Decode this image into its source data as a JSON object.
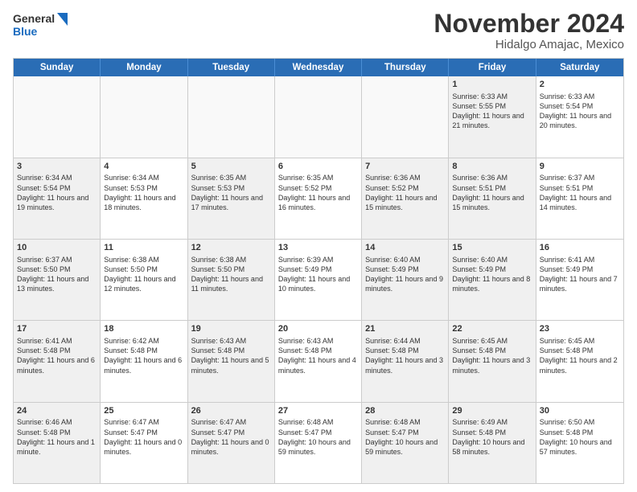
{
  "logo": {
    "line1": "General",
    "line2": "Blue"
  },
  "header": {
    "month": "November 2024",
    "location": "Hidalgo Amajac, Mexico"
  },
  "weekdays": [
    "Sunday",
    "Monday",
    "Tuesday",
    "Wednesday",
    "Thursday",
    "Friday",
    "Saturday"
  ],
  "rows": [
    [
      {
        "day": "",
        "text": "",
        "empty": true
      },
      {
        "day": "",
        "text": "",
        "empty": true
      },
      {
        "day": "",
        "text": "",
        "empty": true
      },
      {
        "day": "",
        "text": "",
        "empty": true
      },
      {
        "day": "",
        "text": "",
        "empty": true
      },
      {
        "day": "1",
        "text": "Sunrise: 6:33 AM\nSunset: 5:55 PM\nDaylight: 11 hours and 21 minutes.",
        "shaded": true
      },
      {
        "day": "2",
        "text": "Sunrise: 6:33 AM\nSunset: 5:54 PM\nDaylight: 11 hours and 20 minutes.",
        "shaded": false
      }
    ],
    [
      {
        "day": "3",
        "text": "Sunrise: 6:34 AM\nSunset: 5:54 PM\nDaylight: 11 hours and 19 minutes.",
        "shaded": true
      },
      {
        "day": "4",
        "text": "Sunrise: 6:34 AM\nSunset: 5:53 PM\nDaylight: 11 hours and 18 minutes.",
        "shaded": false
      },
      {
        "day": "5",
        "text": "Sunrise: 6:35 AM\nSunset: 5:53 PM\nDaylight: 11 hours and 17 minutes.",
        "shaded": true
      },
      {
        "day": "6",
        "text": "Sunrise: 6:35 AM\nSunset: 5:52 PM\nDaylight: 11 hours and 16 minutes.",
        "shaded": false
      },
      {
        "day": "7",
        "text": "Sunrise: 6:36 AM\nSunset: 5:52 PM\nDaylight: 11 hours and 15 minutes.",
        "shaded": true
      },
      {
        "day": "8",
        "text": "Sunrise: 6:36 AM\nSunset: 5:51 PM\nDaylight: 11 hours and 15 minutes.",
        "shaded": true
      },
      {
        "day": "9",
        "text": "Sunrise: 6:37 AM\nSunset: 5:51 PM\nDaylight: 11 hours and 14 minutes.",
        "shaded": false
      }
    ],
    [
      {
        "day": "10",
        "text": "Sunrise: 6:37 AM\nSunset: 5:50 PM\nDaylight: 11 hours and 13 minutes.",
        "shaded": true
      },
      {
        "day": "11",
        "text": "Sunrise: 6:38 AM\nSunset: 5:50 PM\nDaylight: 11 hours and 12 minutes.",
        "shaded": false
      },
      {
        "day": "12",
        "text": "Sunrise: 6:38 AM\nSunset: 5:50 PM\nDaylight: 11 hours and 11 minutes.",
        "shaded": true
      },
      {
        "day": "13",
        "text": "Sunrise: 6:39 AM\nSunset: 5:49 PM\nDaylight: 11 hours and 10 minutes.",
        "shaded": false
      },
      {
        "day": "14",
        "text": "Sunrise: 6:40 AM\nSunset: 5:49 PM\nDaylight: 11 hours and 9 minutes.",
        "shaded": true
      },
      {
        "day": "15",
        "text": "Sunrise: 6:40 AM\nSunset: 5:49 PM\nDaylight: 11 hours and 8 minutes.",
        "shaded": true
      },
      {
        "day": "16",
        "text": "Sunrise: 6:41 AM\nSunset: 5:49 PM\nDaylight: 11 hours and 7 minutes.",
        "shaded": false
      }
    ],
    [
      {
        "day": "17",
        "text": "Sunrise: 6:41 AM\nSunset: 5:48 PM\nDaylight: 11 hours and 6 minutes.",
        "shaded": true
      },
      {
        "day": "18",
        "text": "Sunrise: 6:42 AM\nSunset: 5:48 PM\nDaylight: 11 hours and 6 minutes.",
        "shaded": false
      },
      {
        "day": "19",
        "text": "Sunrise: 6:43 AM\nSunset: 5:48 PM\nDaylight: 11 hours and 5 minutes.",
        "shaded": true
      },
      {
        "day": "20",
        "text": "Sunrise: 6:43 AM\nSunset: 5:48 PM\nDaylight: 11 hours and 4 minutes.",
        "shaded": false
      },
      {
        "day": "21",
        "text": "Sunrise: 6:44 AM\nSunset: 5:48 PM\nDaylight: 11 hours and 3 minutes.",
        "shaded": true
      },
      {
        "day": "22",
        "text": "Sunrise: 6:45 AM\nSunset: 5:48 PM\nDaylight: 11 hours and 3 minutes.",
        "shaded": true
      },
      {
        "day": "23",
        "text": "Sunrise: 6:45 AM\nSunset: 5:48 PM\nDaylight: 11 hours and 2 minutes.",
        "shaded": false
      }
    ],
    [
      {
        "day": "24",
        "text": "Sunrise: 6:46 AM\nSunset: 5:48 PM\nDaylight: 11 hours and 1 minute.",
        "shaded": true
      },
      {
        "day": "25",
        "text": "Sunrise: 6:47 AM\nSunset: 5:47 PM\nDaylight: 11 hours and 0 minutes.",
        "shaded": false
      },
      {
        "day": "26",
        "text": "Sunrise: 6:47 AM\nSunset: 5:47 PM\nDaylight: 11 hours and 0 minutes.",
        "shaded": true
      },
      {
        "day": "27",
        "text": "Sunrise: 6:48 AM\nSunset: 5:47 PM\nDaylight: 10 hours and 59 minutes.",
        "shaded": false
      },
      {
        "day": "28",
        "text": "Sunrise: 6:48 AM\nSunset: 5:47 PM\nDaylight: 10 hours and 59 minutes.",
        "shaded": true
      },
      {
        "day": "29",
        "text": "Sunrise: 6:49 AM\nSunset: 5:48 PM\nDaylight: 10 hours and 58 minutes.",
        "shaded": true
      },
      {
        "day": "30",
        "text": "Sunrise: 6:50 AM\nSunset: 5:48 PM\nDaylight: 10 hours and 57 minutes.",
        "shaded": false
      }
    ]
  ]
}
